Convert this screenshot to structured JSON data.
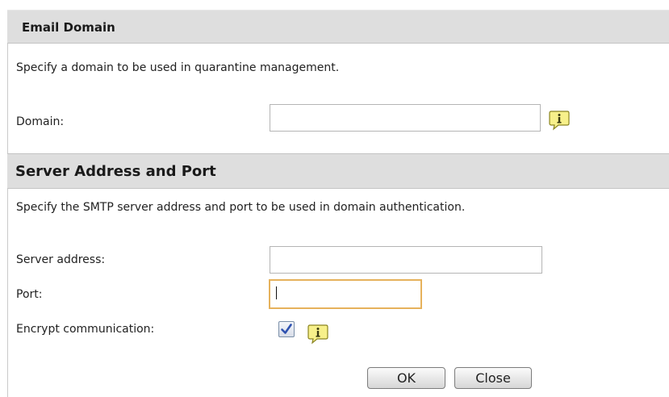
{
  "email_domain": {
    "header": "Email Domain",
    "description": "Specify a domain to be used in quarantine management.",
    "domain_label": "Domain:",
    "domain_value": "",
    "domain_info_icon": "info-speech-bubble-icon"
  },
  "server": {
    "header": "Server Address and Port",
    "description": "Specify the SMTP server address and port to be used in domain authentication.",
    "address_label": "Server address:",
    "address_value": "",
    "port_label": "Port:",
    "port_value": "",
    "encrypt_label": "Encrypt communication:",
    "encrypt_checked": true,
    "encrypt_info_icon": "info-speech-bubble-icon"
  },
  "actions": {
    "ok_label": "OK",
    "close_label": "Close"
  },
  "colors": {
    "header_bg": "#dedede",
    "focus_border": "#e6b25c",
    "checkmark": "#2f52b0",
    "info_icon_fill": "#f7f08a"
  }
}
